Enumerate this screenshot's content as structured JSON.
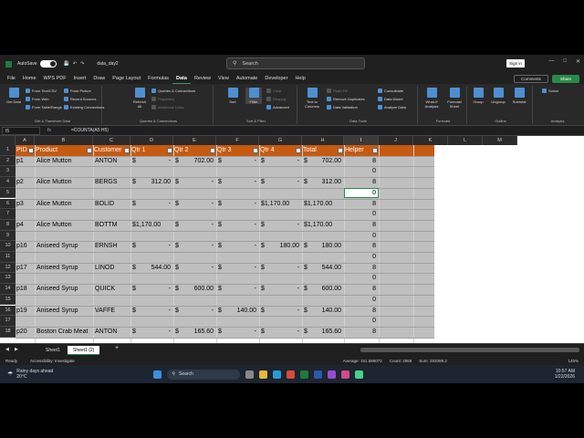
{
  "titlebar": {
    "autosave_label": "AutoSave",
    "toggle_state": "Off",
    "filename": "data_day2",
    "search_placeholder": "Search",
    "signin_label": "Sign in"
  },
  "menu": [
    "File",
    "Home",
    "WPS PDF",
    "Insert",
    "Draw",
    "Page Layout",
    "Formulas",
    "Data",
    "Review",
    "View",
    "Automate",
    "Developer",
    "Help"
  ],
  "menu_active": "Data",
  "comments_label": "Comments",
  "share_label": "Share",
  "ribbon": {
    "get_data": "Get Data",
    "from_text": "From Text/CSV",
    "from_web": "From Web",
    "from_table": "From Table/Range",
    "from_picture": "From Picture",
    "recent_sources": "Recent Sources",
    "existing_connections": "Existing Connections",
    "group1": "Get & Transform Data",
    "refresh_all": "Refresh All",
    "queries_connections": "Queries & Connections",
    "properties": "Properties",
    "workbook_links": "Workbook Links",
    "group2": "Queries & Connections",
    "sort": "Sort",
    "filter": "Filter",
    "clear": "Clear",
    "reapply": "Reapply",
    "advanced": "Advanced",
    "group3": "Sort & Filter",
    "text_to_columns": "Text to Columns",
    "flash_fill": "Flash Fill",
    "remove_duplicates": "Remove Duplicates",
    "data_validation": "Data Validation",
    "consolidate": "Consolidate",
    "data_model": "Data Model",
    "analyze_data": "Analyze Data",
    "group4": "Data Tools",
    "what_if": "What-If Analysis",
    "forecast_sheet": "Forecast Sheet",
    "group5": "Forecast",
    "group_btn": "Group",
    "ungroup": "Ungroup",
    "subtotal": "Subtotal",
    "group6": "Outline",
    "solver": "Solver",
    "group7": "Analysis"
  },
  "formula_bar": {
    "name_box": "I5",
    "fx": "fx",
    "formula": "=COUNTA(A5:H5)"
  },
  "columns": [
    "A",
    "B",
    "C",
    "D",
    "E",
    "F",
    "G",
    "H",
    "I",
    "J",
    "K",
    "L",
    "M"
  ],
  "header_row": {
    "row_num": "1",
    "cells": [
      "PID",
      "Product",
      "Customer",
      "Qtr 1",
      "Qtr 2",
      "Qtr 3",
      "Qtr 4",
      "Total",
      "Helper"
    ]
  },
  "rows": [
    {
      "num": "2",
      "cells": [
        "p1",
        "Alice Mutton",
        "ANTON",
        "$",
        "-",
        "$",
        "702.00",
        "$",
        "-",
        "$",
        "-",
        "$",
        "702.00",
        "8"
      ]
    },
    {
      "num": "3",
      "helper": "0"
    },
    {
      "num": "4",
      "cells": [
        "p2",
        "Alice Mutton",
        "BERGS",
        "$",
        "312.00",
        "$",
        "-",
        "$",
        "-",
        "$",
        "-",
        "$",
        "312.00",
        "8"
      ]
    },
    {
      "num": "5",
      "helper": "0"
    },
    {
      "num": "6",
      "cells": [
        "p3",
        "Alice Mutton",
        "BOLID",
        "$",
        "-",
        "$",
        "-",
        "$",
        "-",
        "$1,170.00",
        "",
        "$1,170.00",
        "",
        "8"
      ]
    },
    {
      "num": "7",
      "helper": "0"
    },
    {
      "num": "8",
      "cells": [
        "p4",
        "Alice Mutton",
        "BOTTM",
        "$1,170.00",
        "",
        "$",
        "-",
        "$",
        "-",
        "$",
        "-",
        "$1,170.00",
        "",
        "8"
      ]
    },
    {
      "num": "9",
      "helper": "0"
    },
    {
      "num": "10",
      "cells": [
        "p16",
        "Aniseed Syrup",
        "ERNSH",
        "$",
        "-",
        "$",
        "-",
        "$",
        "-",
        "$",
        "180.00",
        "$",
        "180.00",
        "8"
      ]
    },
    {
      "num": "11",
      "helper": "0"
    },
    {
      "num": "12",
      "cells": [
        "p17",
        "Aniseed Syrup",
        "LINOD",
        "$",
        "544.00",
        "$",
        "-",
        "$",
        "-",
        "$",
        "-",
        "$",
        "544.00",
        "8"
      ]
    },
    {
      "num": "13",
      "helper": "0"
    },
    {
      "num": "14",
      "cells": [
        "p18",
        "Aniseed Syrup",
        "QUICK",
        "$",
        "-",
        "$",
        "600.00",
        "$",
        "-",
        "$",
        "-",
        "$",
        "600.00",
        "8"
      ]
    },
    {
      "num": "15",
      "helper": "0"
    },
    {
      "num": "16",
      "cells": [
        "p19",
        "Aniseed Syrup",
        "VAFFE",
        "$",
        "-",
        "$",
        "-",
        "$",
        "140.00",
        "$",
        "-",
        "$",
        "140.00",
        "8"
      ]
    },
    {
      "num": "17",
      "helper": "0"
    },
    {
      "num": "18",
      "cells": [
        "p20",
        "Boston Crab Meat",
        "ANTON",
        "$",
        "-",
        "$",
        "165.60",
        "$",
        "-",
        "$",
        "-",
        "$",
        "165.60",
        "8"
      ]
    }
  ],
  "sheet_tabs": [
    "Sheet1",
    "Sheet1 (2)"
  ],
  "active_tab": "Sheet1 (2)",
  "status": {
    "ready": "Ready",
    "accessibility": "Accessibility: Investigate",
    "average": "Average: 151.586072",
    "count": "Count: 2868",
    "sum": "Sum: 282098.2",
    "zoom": "145%"
  },
  "taskbar": {
    "weather": "Rainy days ahead",
    "temp": "20°C",
    "search": "Search",
    "time": "10:57 AM",
    "date": "1/22/2026"
  },
  "colors": {
    "header_fill": "#c55a11",
    "selected_fill": "#bfbfbf",
    "excel_green": "#2a8a4a"
  }
}
